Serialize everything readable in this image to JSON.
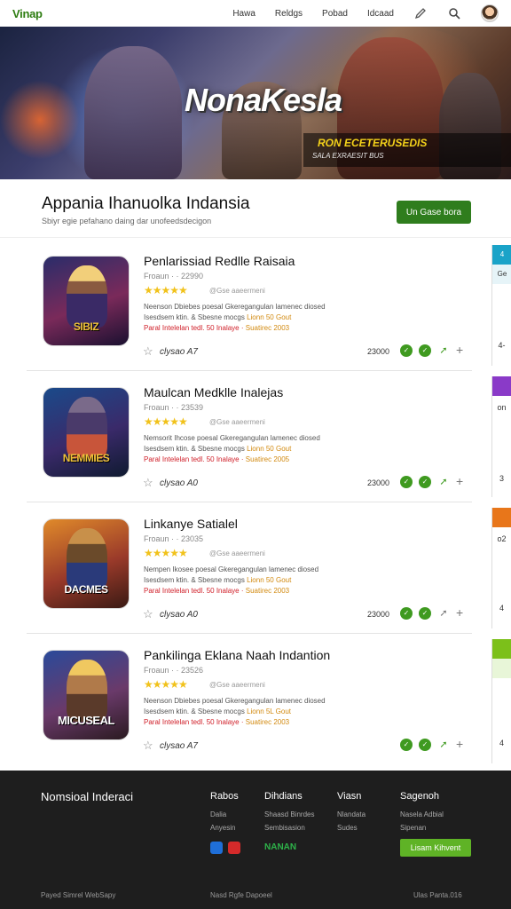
{
  "header": {
    "logo": "Vinap",
    "nav": [
      "Hawa",
      "Reldgs",
      "Pobad",
      "Idcaad"
    ]
  },
  "hero": {
    "title": "NonaKesla",
    "subtitle": "RON ECETERUSEDIS",
    "tagline": "SALA EXRAESIT BUS"
  },
  "section": {
    "title": "Appania Ihanuolka Indansia",
    "subtitle": "Sbiyr egie pefahano daing dar unofeedsdecigon",
    "button": "Un Gase bora"
  },
  "games": [
    {
      "title": "Penlarissiad Redlle Raisaia",
      "meta": "Froaun · · 22990",
      "stars": "★★★★★",
      "rating_note": "@Gse aaeermeni",
      "desc1": "Neenson Dbiebes poesal Gkeregangulan lamenec diosed",
      "desc2_a": "Isesdsem ktin. & Sbesne mocgs",
      "desc2_hl": "Lionn 50 Gout",
      "desc3_a": "Paral Intelelan tedl. 50 Inalaye ·",
      "desc3_hl": "Suatirec 2003",
      "thumb_text": "SIBIZ",
      "clock": "clysao A7",
      "count": "23000"
    },
    {
      "title": "Maulcan Medklle Inalejas",
      "meta": "Froaun · · 23539",
      "stars": "★★★★★",
      "rating_note": "@Gse aaeermeni",
      "desc1": "Nemsorit Ihcose poesal Gkeregangulan lamenec diosed",
      "desc2_a": "Isesdsem ktin. & Sbesne mocgs",
      "desc2_hl": "Lionn 50 Gout",
      "desc3_a": "Paral Intelelan tedl. 50 Inalaye ·",
      "desc3_hl": "Suatirec 2005",
      "thumb_text": "NEMMIES",
      "clock": "clysao A0",
      "count": "23000"
    },
    {
      "title": "Linkanye Satialel",
      "meta": "Froaun · · 23035",
      "stars": "★★★★★",
      "rating_note": "@Gse aaeermeni",
      "desc1": "Nempen Ikosee poesal Gkeregangulan lamenec diosed",
      "desc2_a": "Isesdsem ktin. & Sbesne mocgs",
      "desc2_hl": "Lionn 50 Gout",
      "desc3_a": "Paral Intelelan tedl. 50 Inalaye ·",
      "desc3_hl": "Suatirec 2003",
      "thumb_text": "DACMES",
      "clock": "clysao A0",
      "count": "23000"
    },
    {
      "title": "Pankilinga Eklana Naah Indantion",
      "meta": "Froaun · · 23526",
      "stars": "★★★★★",
      "rating_note": "@Gse aaeermeni",
      "desc1": "Neenson Dbiebes poesal Gkeregangulan lamenec diosed",
      "desc2_a": "Isesdsem ktin. & Sbesne mocgs",
      "desc2_hl": "Lionn 5L Gout",
      "desc3_a": "Paral Intelelan tedl. 50 Inalaye ·",
      "desc3_hl": "Suatirec 2003",
      "thumb_text": "MICUSEAL",
      "clock": "clysao A7",
      "count": "23000"
    }
  ],
  "side": {
    "labels": [
      "4",
      "Ge",
      "4-",
      "",
      "on",
      "3",
      "",
      "o2",
      "4",
      "",
      "",
      "4"
    ]
  },
  "footer": {
    "brand": "Nomsioal Inderaci",
    "col1": {
      "head": "Rabos",
      "items": [
        "Dalia",
        "Anyesin"
      ]
    },
    "col2": {
      "head": "Dihdians",
      "items": [
        "Shaasd Binrdes",
        "Sembisasion"
      ]
    },
    "col3": {
      "head": "Viasn",
      "items": [
        "Nlandata",
        "Sudes"
      ]
    },
    "col4": {
      "head": "Sagenoh",
      "items": [
        "Nasela Adbial",
        "Sipenan"
      ]
    },
    "brand2": "NANAN",
    "button": "Lisam Kihvent",
    "bottom": [
      "Payed Simrel WebSapy",
      "Nasd Rgfe Dapoeel",
      "Ulas Panta.016"
    ]
  },
  "colors": {
    "brand_green": "#2f7d1d",
    "accent_green": "#3f9a20",
    "star": "#f1c21b",
    "alert_red": "#d0202a"
  }
}
